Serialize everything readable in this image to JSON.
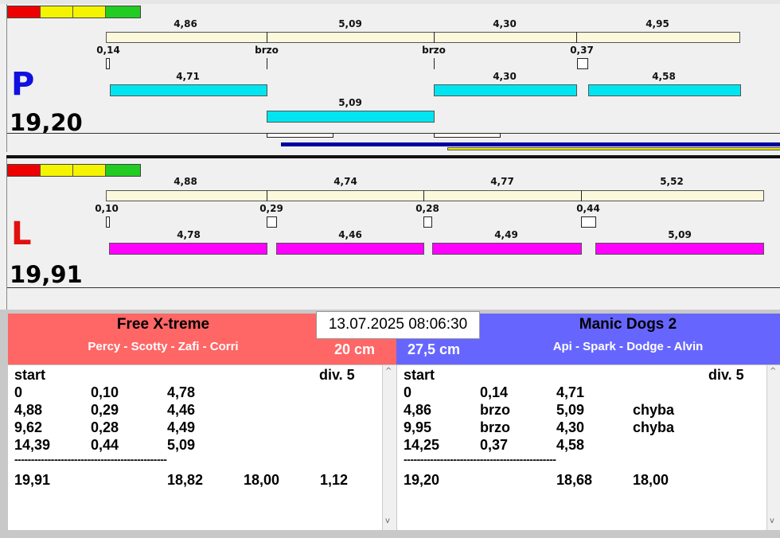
{
  "top_lane": {
    "letter": "P",
    "total": "19,20",
    "split_labels": [
      "4,86",
      "5,09",
      "4,30",
      "4,95"
    ],
    "cross_labels": [
      "0,14",
      "brzo",
      "brzo",
      "0,37"
    ],
    "run_labels": [
      "4,71",
      "4,30",
      "4,58",
      "5,09"
    ]
  },
  "bottom_lane": {
    "letter": "L",
    "total": "19,91",
    "split_labels": [
      "4,88",
      "4,74",
      "4,77",
      "5,52"
    ],
    "cross_labels": [
      "0,10",
      "0,29",
      "0,28",
      "0,44"
    ],
    "run_labels": [
      "4,78",
      "4,46",
      "4,49",
      "5,09"
    ]
  },
  "colors": {
    "cyan": "#00e5ef",
    "magenta": "#ff00ff",
    "cream": "#fcf8dc",
    "left_header": "#ff6666",
    "right_header": "#6666ff",
    "blue_line": "#0000a0",
    "yellow_line": "#e8e800"
  },
  "datetime": "13.07.2025 08:06:30",
  "left_team": {
    "name": "Free X-treme",
    "members": "Percy - Scotty - Zafi - Corri",
    "height": "20 cm",
    "table": {
      "head_start": "start",
      "head_div": "div. 5",
      "rows": [
        [
          "0",
          "0,10",
          "4,78",
          ""
        ],
        [
          "4,88",
          "0,29",
          "4,46",
          ""
        ],
        [
          "9,62",
          "0,28",
          "4,49",
          ""
        ],
        [
          "14,39",
          "0,44",
          "5,09",
          ""
        ]
      ],
      "separator": "----------------------------------------------",
      "total": [
        "19,91",
        "18,82",
        "18,00",
        "1,12"
      ]
    }
  },
  "right_team": {
    "name": "Manic Dogs 2",
    "members": "Api - Spark - Dodge - Alvin",
    "height": "27,5 cm",
    "table": {
      "head_start": "start",
      "head_div": "div. 5",
      "rows": [
        [
          "0",
          "0,14",
          "4,71",
          ""
        ],
        [
          "4,86",
          "brzo",
          "5,09",
          "chyba"
        ],
        [
          "9,95",
          "brzo",
          "4,30",
          "chyba"
        ],
        [
          "14,25",
          "0,37",
          "4,58",
          ""
        ]
      ],
      "separator": "----------------------------------------------",
      "total": [
        "19,20",
        "18,68",
        "18,00"
      ]
    }
  }
}
